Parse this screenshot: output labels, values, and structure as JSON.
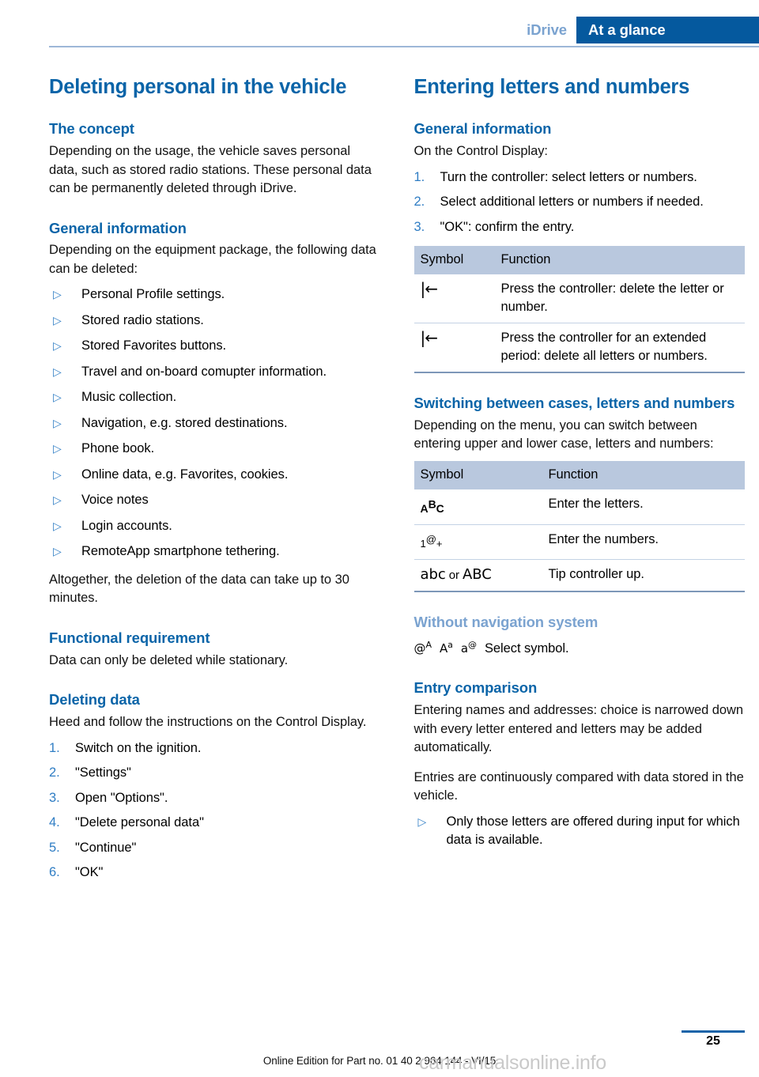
{
  "header": {
    "chapter": "iDrive",
    "section": "At a glance"
  },
  "left_column": {
    "title": "Deleting personal in the vehicle",
    "concept_heading": "The concept",
    "concept_text": "Depending on the usage, the vehicle saves personal data, such as stored radio stations. These personal data can be permanently deleted through iDrive.",
    "general_heading": "General information",
    "general_text": "Depending on the equipment package, the following data can be deleted:",
    "bullets": [
      "Personal Profile settings.",
      "Stored radio stations.",
      "Stored Favorites buttons.",
      "Travel and on-board comupter information.",
      "Music collection.",
      "Navigation, e.g. stored destinations.",
      "Phone book.",
      "Online data, e.g. Favorites, cookies.",
      "Voice notes",
      "Login accounts.",
      "RemoteApp smartphone tethering."
    ],
    "altogether_text": "Altogether, the deletion of the data can take up to 30 minutes.",
    "functional_heading": "Functional requirement",
    "functional_text": "Data can only be deleted while stationary.",
    "deleting_heading": "Deleting data",
    "deleting_text": "Heed and follow the instructions on the Control Display.",
    "steps": [
      {
        "num": "1.",
        "text": "Switch on the ignition."
      },
      {
        "num": "2.",
        "text": "\"Settings\""
      },
      {
        "num": "3.",
        "text": "Open \"Options\"."
      },
      {
        "num": "4.",
        "text": "\"Delete personal data\""
      },
      {
        "num": "5.",
        "text": "\"Continue\""
      },
      {
        "num": "6.",
        "text": "\"OK\""
      }
    ]
  },
  "right_column": {
    "title": "Entering letters and numbers",
    "general_heading": "General information",
    "general_text": "On the Control Display:",
    "steps": [
      {
        "num": "1.",
        "text": "Turn the controller: select letters or numbers."
      },
      {
        "num": "2.",
        "text": "Select additional letters or numbers if needed."
      },
      {
        "num": "3.",
        "text": "\"OK\": confirm the entry."
      }
    ],
    "table1": {
      "headers": [
        "Symbol",
        "Function"
      ],
      "rows": [
        {
          "symbol": "|←",
          "symbol_name": "backspace-icon",
          "function": "Press the controller: delete the letter or number."
        },
        {
          "symbol": "|←",
          "symbol_name": "backspace-icon",
          "function": "Press the controller for an extended period: delete all letters or numbers."
        }
      ]
    },
    "switching_heading": "Switching between cases, letters and numbers",
    "switching_text": "Depending on the menu, you can switch between entering upper and lower case, letters and numbers:",
    "table2": {
      "headers": [
        "Symbol",
        "Function"
      ],
      "rows": [
        {
          "symbol": "AᴮC",
          "symbol_name": "uppercase-abc-icon",
          "function": "Enter the letters."
        },
        {
          "symbol": "1@+",
          "symbol_name": "numbers-symbols-icon",
          "function": "Enter the numbers."
        },
        {
          "symbol": "abc or ABC",
          "symbol_name": "case-toggle-icon",
          "function": "Tip controller up."
        }
      ]
    },
    "without_nav_heading": "Without navigation system",
    "without_nav_symbols": [
      "@ᴬ",
      "Aᵃ",
      "a@"
    ],
    "without_nav_text": "Select symbol.",
    "entry_heading": "Entry comparison",
    "entry_text_1": "Entering names and addresses: choice is narrowed down with every letter entered and letters may be added automatically.",
    "entry_text_2": "Entries are continuously compared with data stored in the vehicle.",
    "entry_bullets": [
      "Only those letters are offered during input for which data is available."
    ]
  },
  "footer": {
    "page_number": "25",
    "online_edition": "Online Edition for Part no. 01 40 2 964 144 - VI/15",
    "watermark": "carmanualsonline.info"
  },
  "colors": {
    "brand_blue": "#0a64a8",
    "header_tab_blue": "#05599e",
    "light_blue": "#7ba3d0",
    "table_header_bg": "#b9c8de",
    "bullet_blue": "#2f7dc4"
  }
}
